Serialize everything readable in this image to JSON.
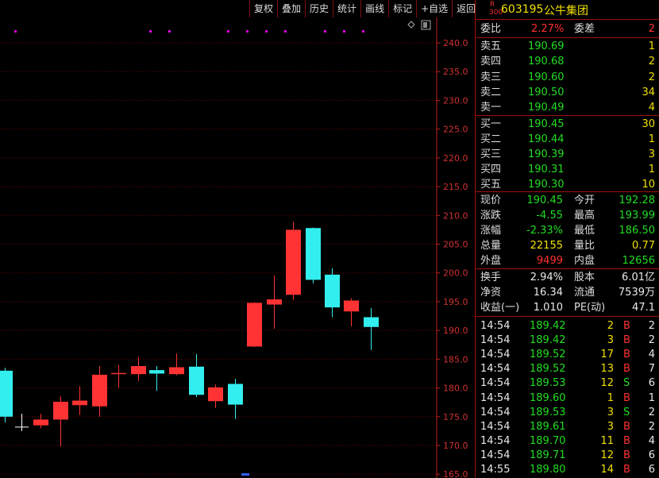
{
  "toolbar": [
    "复权",
    "叠加",
    "历史",
    "统计",
    "画线",
    "标记",
    "+自选",
    "返回"
  ],
  "header": {
    "tag_top": "R",
    "tag_bottom": "300",
    "code": "603195",
    "name": "公牛集团"
  },
  "weibi": {
    "label1": "委比",
    "value1": "2.27%",
    "label2": "委差",
    "value2": "2"
  },
  "sell": [
    {
      "label": "卖五",
      "price": "190.69",
      "vol": "1"
    },
    {
      "label": "卖四",
      "price": "190.68",
      "vol": "2"
    },
    {
      "label": "卖三",
      "price": "190.60",
      "vol": "2"
    },
    {
      "label": "卖二",
      "price": "190.50",
      "vol": "34"
    },
    {
      "label": "卖一",
      "price": "190.49",
      "vol": "4"
    }
  ],
  "buy": [
    {
      "label": "买一",
      "price": "190.45",
      "vol": "30"
    },
    {
      "label": "买二",
      "price": "190.44",
      "vol": "1"
    },
    {
      "label": "买三",
      "price": "190.39",
      "vol": "3"
    },
    {
      "label": "买四",
      "price": "190.31",
      "vol": "1"
    },
    {
      "label": "买五",
      "price": "190.30",
      "vol": "10"
    }
  ],
  "quote": [
    {
      "l1": "现价",
      "v1": "190.45",
      "c1": "green",
      "l2": "今开",
      "v2": "192.28",
      "c2": "green"
    },
    {
      "l1": "涨跌",
      "v1": "-4.55",
      "c1": "green",
      "l2": "最高",
      "v2": "193.99",
      "c2": "green"
    },
    {
      "l1": "涨幅",
      "v1": "-2.33%",
      "c1": "green",
      "l2": "最低",
      "v2": "186.50",
      "c2": "green"
    },
    {
      "l1": "总量",
      "v1": "22155",
      "c1": "yellow",
      "l2": "量比",
      "v2": "0.77",
      "c2": "yellow"
    },
    {
      "l1": "外盘",
      "v1": "9499",
      "c1": "red",
      "l2": "内盘",
      "v2": "12656",
      "c2": "green"
    }
  ],
  "stats": [
    {
      "l1": "换手",
      "v1": "2.94%",
      "l2": "股本",
      "v2": "6.01亿"
    },
    {
      "l1": "净资",
      "v1": "16.34",
      "l2": "流通",
      "v2": "7539万"
    },
    {
      "l1": "收益(一)",
      "v1": "1.010",
      "l2": "PE(动)",
      "v2": "47.1"
    }
  ],
  "ticks": [
    {
      "time": "14:54",
      "price": "189.42",
      "vol": "2",
      "bs": "B",
      "n": "2"
    },
    {
      "time": "14:54",
      "price": "189.42",
      "vol": "3",
      "bs": "B",
      "n": "2"
    },
    {
      "time": "14:54",
      "price": "189.52",
      "vol": "17",
      "bs": "B",
      "n": "4"
    },
    {
      "time": "14:54",
      "price": "189.52",
      "vol": "13",
      "bs": "B",
      "n": "7"
    },
    {
      "time": "14:54",
      "price": "189.53",
      "vol": "12",
      "bs": "S",
      "n": "6"
    },
    {
      "time": "14:54",
      "price": "189.60",
      "vol": "1",
      "bs": "B",
      "n": "1"
    },
    {
      "time": "14:54",
      "price": "189.53",
      "vol": "3",
      "bs": "S",
      "n": "2"
    },
    {
      "time": "14:54",
      "price": "189.61",
      "vol": "3",
      "bs": "B",
      "n": "2"
    },
    {
      "time": "14:54",
      "price": "189.70",
      "vol": "11",
      "bs": "B",
      "n": "4"
    },
    {
      "time": "14:54",
      "price": "189.71",
      "vol": "12",
      "bs": "B",
      "n": "6"
    },
    {
      "time": "14:55",
      "price": "189.80",
      "vol": "14",
      "bs": "B",
      "n": "6"
    }
  ],
  "colors": {
    "up": "#ff3333",
    "down": "#33eeee",
    "grid": "#7a0000",
    "axis": "#c02020",
    "marker": "#e000e0"
  },
  "chart_data": {
    "type": "candlestick",
    "yticks": [
      "240.0",
      "235.0",
      "230.0",
      "225.0",
      "220.0",
      "215.0",
      "210.0",
      "205.0",
      "200.0",
      "195.0",
      "190.0",
      "185.0",
      "180.0",
      "175.0",
      "170.0",
      "165.0"
    ],
    "ylim": [
      165,
      240
    ],
    "candles": [
      {
        "o": 175.0,
        "c": 183.0,
        "h": 183.5,
        "l": 174.0,
        "dir": "down"
      },
      {
        "o": 173.2,
        "c": 173.2,
        "h": 175.5,
        "l": 172.5,
        "dir": "doji"
      },
      {
        "o": 173.5,
        "c": 174.5,
        "h": 175.5,
        "l": 173.0,
        "dir": "up"
      },
      {
        "o": 174.5,
        "c": 177.6,
        "h": 178.5,
        "l": 169.8,
        "dir": "up"
      },
      {
        "o": 177.0,
        "c": 177.8,
        "h": 180.3,
        "l": 175.3,
        "dir": "up"
      },
      {
        "o": 176.8,
        "c": 182.3,
        "h": 183.8,
        "l": 175.0,
        "dir": "up"
      },
      {
        "o": 182.4,
        "c": 182.6,
        "h": 184.0,
        "l": 180.0,
        "dir": "up"
      },
      {
        "o": 182.4,
        "c": 183.8,
        "h": 185.4,
        "l": 181.2,
        "dir": "up"
      },
      {
        "o": 183.1,
        "c": 182.5,
        "h": 183.8,
        "l": 179.5,
        "dir": "down"
      },
      {
        "o": 182.4,
        "c": 183.6,
        "h": 186.0,
        "l": 182.2,
        "dir": "up"
      },
      {
        "o": 183.7,
        "c": 178.8,
        "h": 185.9,
        "l": 178.4,
        "dir": "down"
      },
      {
        "o": 177.7,
        "c": 180.1,
        "h": 180.6,
        "l": 176.5,
        "dir": "up"
      },
      {
        "o": 180.7,
        "c": 177.1,
        "h": 181.6,
        "l": 174.6,
        "dir": "down"
      },
      {
        "o": 187.2,
        "c": 194.8,
        "h": 194.9,
        "l": 187.1,
        "dir": "up"
      },
      {
        "o": 194.5,
        "c": 195.4,
        "h": 199.6,
        "l": 190.3,
        "dir": "up"
      },
      {
        "o": 196.2,
        "c": 207.5,
        "h": 208.9,
        "l": 195.3,
        "dir": "up"
      },
      {
        "o": 207.8,
        "c": 198.8,
        "h": 207.9,
        "l": 198.2,
        "dir": "down"
      },
      {
        "o": 199.7,
        "c": 194.0,
        "h": 200.8,
        "l": 192.3,
        "dir": "down"
      },
      {
        "o": 193.3,
        "c": 195.2,
        "h": 195.6,
        "l": 190.7,
        "dir": "up"
      },
      {
        "o": 192.3,
        "c": 190.6,
        "h": 193.9,
        "l": 186.6,
        "dir": "down"
      }
    ]
  }
}
